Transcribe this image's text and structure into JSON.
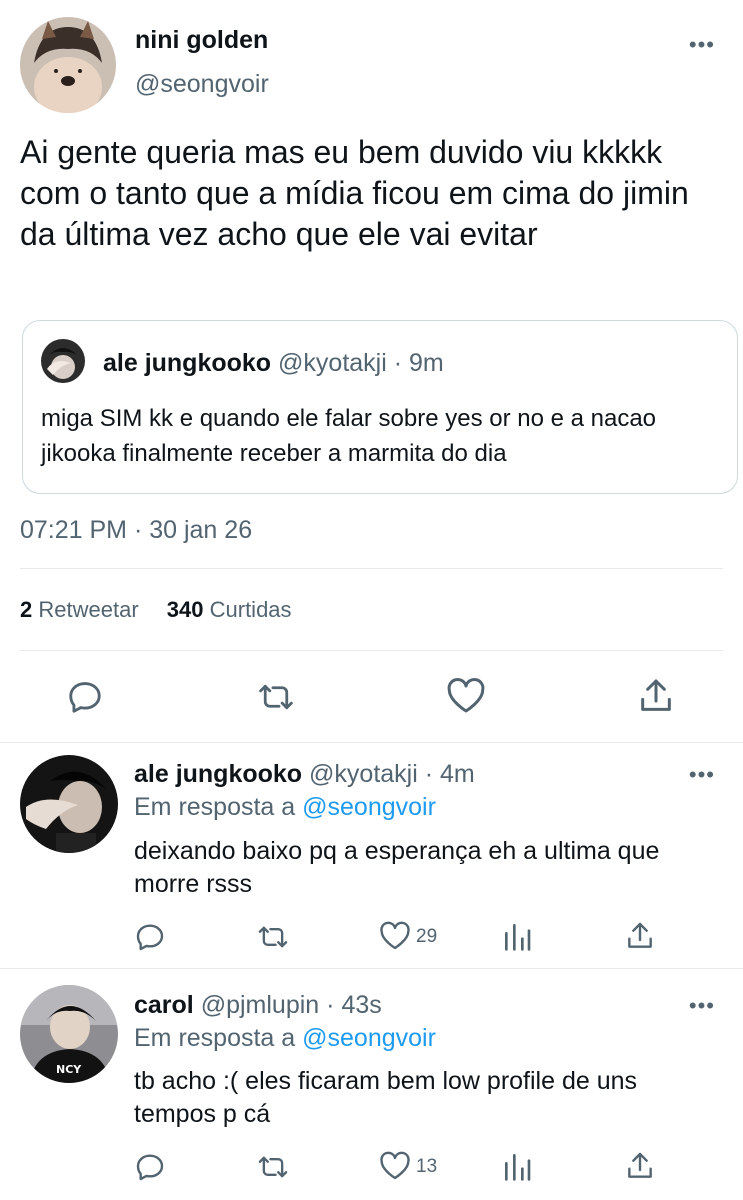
{
  "main_tweet": {
    "display_name": "nini golden",
    "handle": "@seongvoir",
    "text": "Ai gente queria mas eu bem duvido viu kkkkk com o tanto que a mídia ficou em cima do jimin da última vez acho que ele vai evitar",
    "quote": {
      "display_name": "ale jungkooko",
      "handle": "@kyotakji",
      "dot": "·",
      "time": "9m",
      "text": "miga SIM kk e quando ele falar sobre yes or no e a nacao jikooka finalmente receber a marmita do dia"
    },
    "timestamp": "07:21 PM · 30 jan 26",
    "retweets_count": "2",
    "retweets_label": "Retweetar",
    "likes_count": "340",
    "likes_label": "Curtidas",
    "more_label": "•••"
  },
  "replies": [
    {
      "display_name": "ale jungkooko",
      "handle": "@kyotakji",
      "dot": "·",
      "time": "4m",
      "reply_prefix": "Em resposta a",
      "reply_to": "@seongvoir",
      "text": "deixando baixo pq a esperança eh a ultima que morre rsss",
      "likes": "29",
      "more_label": "•••"
    },
    {
      "display_name": "carol",
      "handle": "@pjmlupin",
      "dot": "·",
      "time": "43s",
      "reply_prefix": "Em resposta a",
      "reply_to": "@seongvoir",
      "text": "tb acho :( eles ficaram bem low profile de uns tempos p cá",
      "likes": "13",
      "more_label": "•••"
    }
  ],
  "icons": {
    "reply": "reply-icon",
    "retweet": "retweet-icon",
    "like": "heart-icon",
    "share": "share-icon",
    "analytics": "analytics-icon",
    "more": "more-icon"
  },
  "colors": {
    "text": "#0f1419",
    "muted": "#536471",
    "link": "#1d9bf0",
    "divider": "#e7e9ea"
  }
}
